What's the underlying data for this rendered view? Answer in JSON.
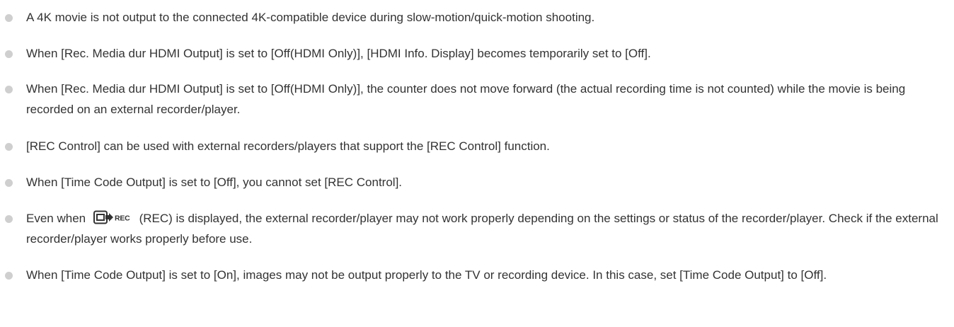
{
  "notes": [
    {
      "text": "A 4K movie is not output to the connected 4K-compatible device during slow-motion/quick-motion shooting."
    },
    {
      "text": "When [Rec. Media dur HDMI Output] is set to [Off(HDMI Only)], [HDMI Info. Display] becomes temporarily set to [Off]."
    },
    {
      "text": "When [Rec. Media dur HDMI Output] is set to [Off(HDMI Only)], the counter does not move forward (the actual recording time is not counted) while the movie is being recorded on an external recorder/player."
    },
    {
      "text": "[REC Control] can be used with external recorders/players that support the [REC Control] function."
    },
    {
      "text": "When [Time Code Output] is set to [Off], you cannot set [REC Control]."
    },
    {
      "text_before_icon": "Even when",
      "icon": "hdmi-rec-icon",
      "icon_label": "REC",
      "text_after_icon": " (REC) is displayed, the external recorder/player may not work properly depending on the settings or status of the recorder/player. Check if the external recorder/player works properly before use."
    },
    {
      "text": "When [Time Code Output] is set to [On], images may not be output properly to the TV or recording device. In this case, set [Time Code Output] to [Off]."
    }
  ],
  "colors": {
    "text": "#333333",
    "bullet": "#cfcfcf",
    "background": "#ffffff"
  }
}
